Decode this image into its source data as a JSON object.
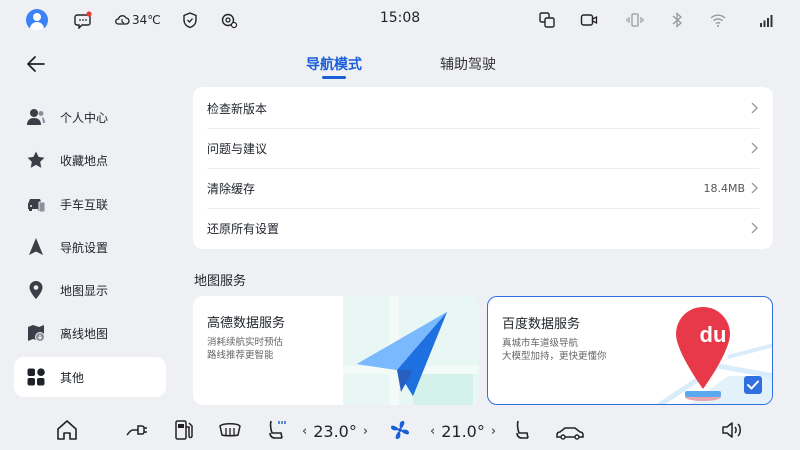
{
  "status_bar": {
    "time": "15:08",
    "temperature": "34℃",
    "icons": [
      "avatar",
      "message-icon",
      "cloud-icon",
      "shield-icon",
      "gear-status-icon",
      "screen-mirror-icon",
      "camera-icon",
      "vibrate-icon",
      "bluetooth-icon",
      "wifi-icon",
      "signal-icon"
    ],
    "notification_dot_color": "#e53935"
  },
  "header": {
    "tabs": [
      {
        "label": "导航模式",
        "active": true
      },
      {
        "label": "辅助驾驶",
        "active": false
      }
    ]
  },
  "sidebar": {
    "items": [
      {
        "label": "个人中心",
        "icon": "person-icon"
      },
      {
        "label": "收藏地点",
        "icon": "star-icon"
      },
      {
        "label": "手车互联",
        "icon": "car-connect-icon"
      },
      {
        "label": "导航设置",
        "icon": "navigation-arrow-icon"
      },
      {
        "label": "地图显示",
        "icon": "map-pin-icon"
      },
      {
        "label": "离线地图",
        "icon": "offline-map-icon"
      },
      {
        "label": "其他",
        "icon": "apps-grid-icon",
        "active": true
      }
    ]
  },
  "settings": {
    "rows": [
      {
        "label": "检查新版本",
        "value": ""
      },
      {
        "label": "问题与建议",
        "value": ""
      },
      {
        "label": "清除缓存",
        "value": "18.4MB"
      },
      {
        "label": "还原所有设置",
        "value": ""
      }
    ]
  },
  "map_services": {
    "title": "地图服务",
    "cards": [
      {
        "title": "高德数据服务",
        "desc": [
          "消耗续航实时预估",
          "路线推荐更智能"
        ],
        "selected": false
      },
      {
        "title": "百度数据服务",
        "desc": [
          "真城市车道级导航",
          "大模型加持，更快更懂你"
        ],
        "selected": true,
        "logo_text": "du"
      }
    ]
  },
  "bottom_bar": {
    "left_temp": "23.0°",
    "right_temp": "21.0°",
    "icons": [
      "home-icon",
      "charge-plug-icon",
      "fuel-icon",
      "rear-defrost-icon",
      "seat-heat-icon",
      "fan-icon",
      "seat-icon",
      "car-icon",
      "volume-icon"
    ],
    "accent": "#1a5fd8"
  }
}
